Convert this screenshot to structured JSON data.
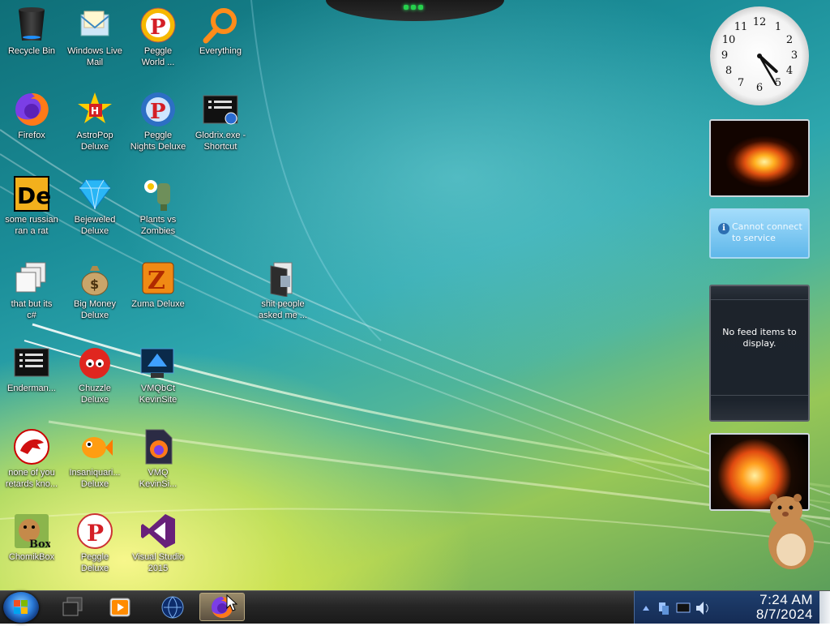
{
  "desktop": {
    "icons": [
      {
        "label": "Recycle Bin",
        "icon": "recycle-bin-icon"
      },
      {
        "label": "Windows Live\nMail",
        "icon": "mail-icon"
      },
      {
        "label": "Peggle\nWorld ...",
        "icon": "peggle-icon"
      },
      {
        "label": "Everything",
        "icon": "search-magnifier-icon"
      },
      {
        "label": "Firefox",
        "icon": "firefox-icon"
      },
      {
        "label": "AstroPop\nDeluxe",
        "icon": "astropop-icon"
      },
      {
        "label": "Peggle\nNights Deluxe",
        "icon": "peggle-nights-icon"
      },
      {
        "label": "Glodrix.exe -\nShortcut",
        "icon": "terminal-shortcut-icon"
      },
      {
        "label": "some russian\nran a rat",
        "icon": "de-icon"
      },
      {
        "label": "Bejeweled\nDeluxe",
        "icon": "diamond-icon"
      },
      {
        "label": "Plants vs\nZombies",
        "icon": "pvz-icon"
      },
      {
        "label": "that but its\nc#",
        "icon": "copy-pages-icon"
      },
      {
        "label": "Big Money\nDeluxe",
        "icon": "money-bag-icon"
      },
      {
        "label": "Zuma Deluxe",
        "icon": "zuma-icon"
      },
      {
        "label": "shit people\nasked me ...",
        "icon": "folder-icon"
      },
      {
        "label": "Enderman...",
        "icon": "terminal-icon"
      },
      {
        "label": "Chuzzle\nDeluxe",
        "icon": "chuzzle-icon"
      },
      {
        "label": "VMQbCt\nKevinSite",
        "icon": "vm-icon"
      },
      {
        "label": "none of you\nretards kno...",
        "icon": "red-dragon-icon"
      },
      {
        "label": "Insaniquari...\nDeluxe",
        "icon": "goldfish-icon"
      },
      {
        "label": "VMQ\nKevinSi...",
        "icon": "firefox-file-icon"
      },
      {
        "label": "ChomikBox",
        "icon": "hamster-box-icon"
      },
      {
        "label": "Peggle\nDeluxe",
        "icon": "peggle-deluxe-icon"
      },
      {
        "label": "Visual Studio\n2015",
        "icon": "visual-studio-icon"
      }
    ]
  },
  "gadgets": {
    "clock_numbers": [
      "12",
      "1",
      "2",
      "3",
      "4",
      "5",
      "6",
      "7",
      "8",
      "9",
      "10",
      "11"
    ],
    "clock_time_shown": {
      "hour": 4,
      "minute": 25
    },
    "weather_message": "Cannot connect\nto service",
    "feed_message": "No feed items to\ndisplay."
  },
  "taskbar": {
    "start_label": "Start",
    "buttons": [
      "window-switcher-icon",
      "media-player-icon",
      "globe-icon",
      "firefox-icon"
    ],
    "active_button": 3,
    "tray_icons": [
      "show-hidden-icon",
      "network-icon",
      "action-center-icon",
      "volume-icon"
    ],
    "time": "7:24 AM",
    "date": "8/7/2024"
  },
  "colors": {
    "taskbar": "#262626",
    "tray": "#1f3f6e",
    "accent_active": "#9a8b6a"
  }
}
